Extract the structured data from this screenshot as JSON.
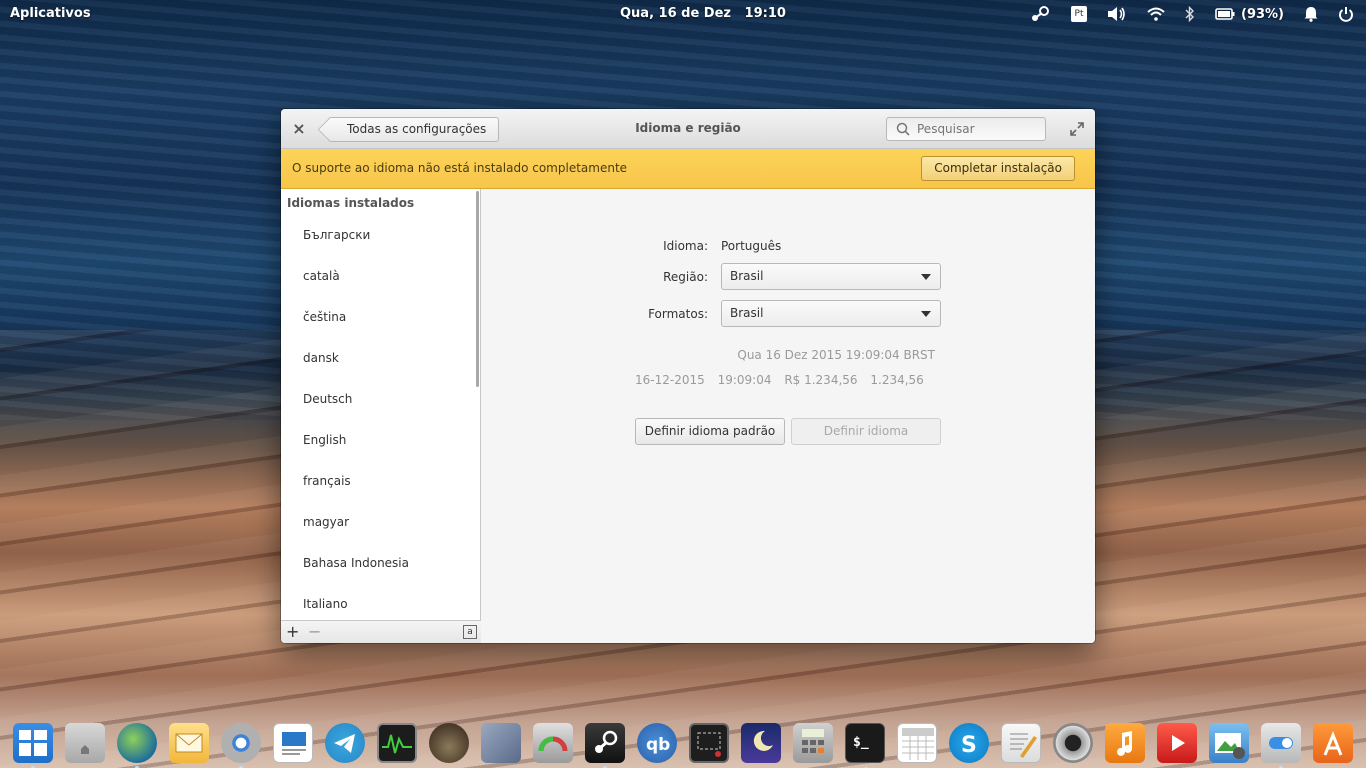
{
  "panel": {
    "apps_label": "Aplicativos",
    "clock": "Qua, 16 de Dez   19:10",
    "keyboard_layout": "Pt",
    "battery": "(93%)"
  },
  "window": {
    "back_label": "Todas as configurações",
    "title": "Idioma e região",
    "search_placeholder": "Pesquisar"
  },
  "infobar": {
    "message": "O suporte ao idioma não está instalado completamente",
    "button_label": "Completar instalação"
  },
  "sidebar": {
    "header": "Idiomas instalados",
    "languages": [
      "Български",
      "català",
      "čeština",
      "dansk",
      "Deutsch",
      "English",
      "français",
      "magyar",
      "Bahasa Indonesia",
      "Italiano"
    ],
    "keyboard_button": "a"
  },
  "settings": {
    "language_label": "Idioma:",
    "language_value": "Português",
    "region_label": "Região:",
    "region_value": "Brasil",
    "formats_label": "Formatos:",
    "formats_value": "Brasil",
    "preview_long": "Qua 16 Dez 2015 19:09:04 BRST",
    "preview_date": "16-12-2015",
    "preview_time": "19:09:04",
    "preview_currency": "R$ 1.234,56",
    "preview_number": "1.234,56",
    "set_default_button": "Definir idioma padrão",
    "set_language_button": "Definir idioma"
  },
  "dock": {
    "icons": [
      "multitasking-view-icon",
      "files-icon",
      "browser-icon",
      "mail-icon",
      "chromium-icon",
      "writer-icon",
      "telegram-icon",
      "system-monitor-icon",
      "gimp-icon",
      "chip-icon",
      "disk-usage-icon",
      "steam-icon",
      "qbittorrent-icon",
      "screenshot-icon",
      "night-sky-icon",
      "calculator-icon",
      "terminal-icon",
      "calendar-icon",
      "skype-icon",
      "text-editor-icon",
      "camera-icon",
      "music-icon",
      "videos-icon",
      "photos-icon",
      "settings-toggle-icon",
      "appcenter-icon"
    ]
  }
}
